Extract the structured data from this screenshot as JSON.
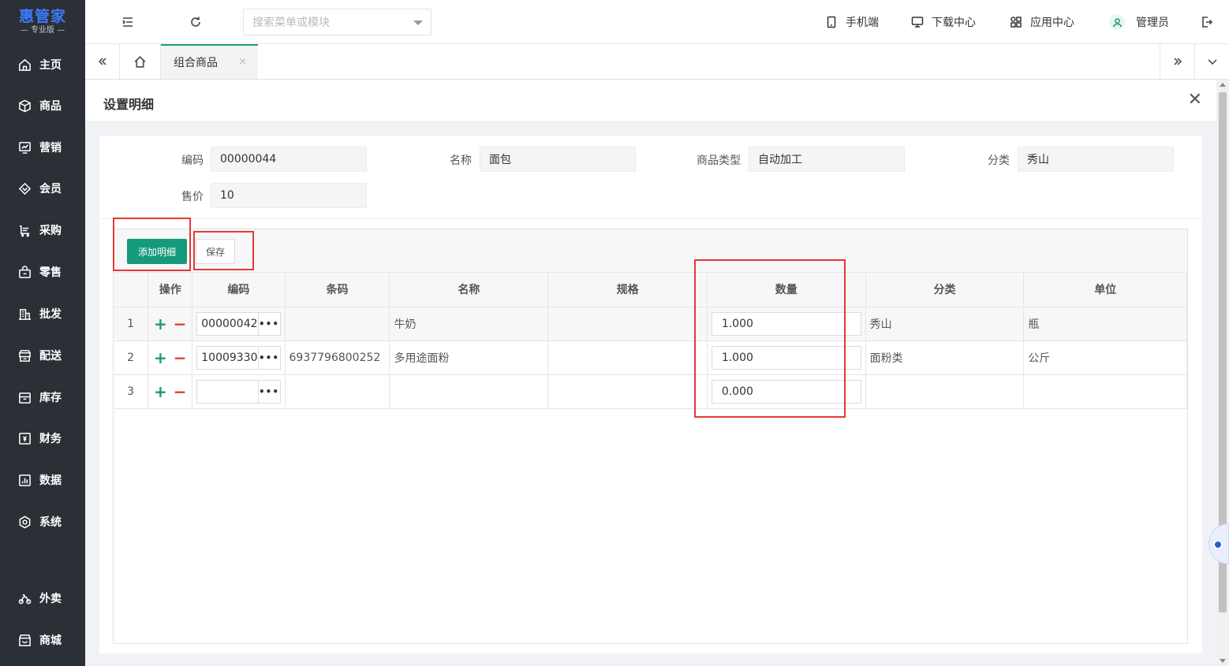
{
  "app": {
    "logo_title": "惠管家",
    "logo_subtitle": "— 专业版 —"
  },
  "sidebar": {
    "items": [
      {
        "label": "主页",
        "icon": "home-icon"
      },
      {
        "label": "商品",
        "icon": "box-icon"
      },
      {
        "label": "营销",
        "icon": "chart-icon"
      },
      {
        "label": "会员",
        "icon": "diamond-icon"
      },
      {
        "label": "采购",
        "icon": "cart-icon"
      },
      {
        "label": "零售",
        "icon": "bag-icon"
      },
      {
        "label": "批发",
        "icon": "building-icon"
      },
      {
        "label": "配送",
        "icon": "delivery-icon"
      },
      {
        "label": "库存",
        "icon": "inventory-icon"
      },
      {
        "label": "财务",
        "icon": "finance-icon"
      },
      {
        "label": "数据",
        "icon": "data-icon"
      },
      {
        "label": "系统",
        "icon": "settings-icon"
      },
      {
        "label": "外卖",
        "icon": "bike-icon"
      },
      {
        "label": "商城",
        "icon": "shop-icon"
      }
    ]
  },
  "topbar": {
    "search_placeholder": "搜索菜单或模块",
    "mobile": "手机端",
    "download": "下载中心",
    "apps": "应用中心",
    "user": "管理员"
  },
  "tabs": {
    "active": "组合商品",
    "close": "×"
  },
  "panel": {
    "title": "设置明细",
    "close": "✕"
  },
  "form": {
    "code_label": "编码",
    "code_value": "00000044",
    "name_label": "名称",
    "name_value": "面包",
    "type_label": "商品类型",
    "type_value": "自动加工",
    "category_label": "分类",
    "category_value": "秀山",
    "price_label": "售价",
    "price_value": "10"
  },
  "toolbar": {
    "add_label": "添加明细",
    "save_label": "保存"
  },
  "grid": {
    "columns": [
      "",
      "操作",
      "编码",
      "条码",
      "名称",
      "规格",
      "数量",
      "分类",
      "单位"
    ],
    "rows": [
      {
        "num": "1",
        "code": "00000042",
        "barcode": "",
        "name": "牛奶",
        "spec": "",
        "qty": "1.000",
        "category": "秀山",
        "unit": "瓶"
      },
      {
        "num": "2",
        "code": "10009330",
        "barcode": "6937796800252",
        "name": "多用途面粉",
        "spec": "",
        "qty": "1.000",
        "category": "面粉类",
        "unit": "公斤"
      },
      {
        "num": "3",
        "code": "",
        "barcode": "",
        "name": "",
        "spec": "",
        "qty": "0.000",
        "category": "",
        "unit": ""
      }
    ],
    "plus": "+",
    "minus": "−",
    "dots": "•••"
  },
  "colors": {
    "sidebar_bg": "#2b2f36",
    "primary": "#159a7c",
    "highlight": "#e53935",
    "logo": "#3d7bff"
  }
}
